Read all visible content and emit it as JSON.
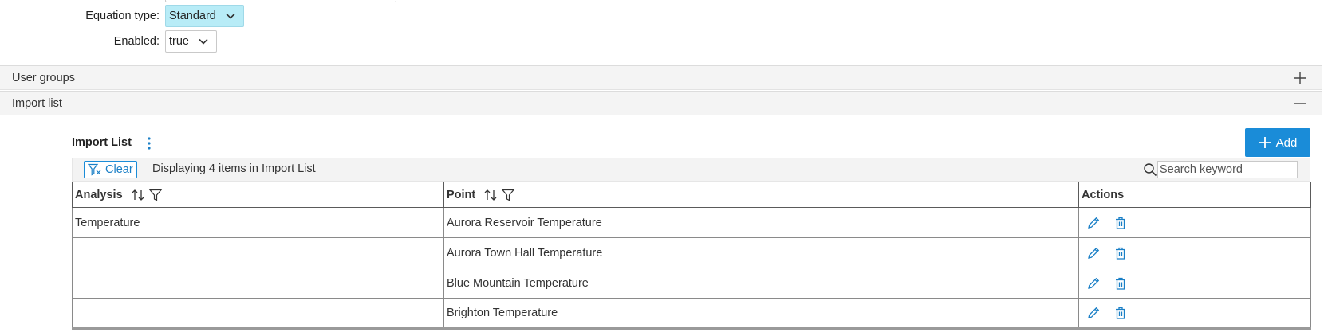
{
  "form": {
    "equation_type_label": "Equation type:",
    "equation_type_value": "Standard",
    "enabled_label": "Enabled:",
    "enabled_value": "true"
  },
  "panels": {
    "user_groups": "User groups",
    "import_list": "Import list"
  },
  "import_list": {
    "title": "Import List",
    "add_label": "Add",
    "clear_label": "Clear",
    "display_text": "Displaying 4 items in Import List",
    "search_placeholder": "Search keyword",
    "columns": [
      "Analysis",
      "Point",
      "Actions"
    ],
    "rows": [
      {
        "analysis": "Temperature",
        "point": "Aurora Reservoir Temperature"
      },
      {
        "analysis": "",
        "point": "Aurora Town Hall Temperature"
      },
      {
        "analysis": "",
        "point": "Blue Mountain Temperature"
      },
      {
        "analysis": "",
        "point": "Brighton Temperature"
      }
    ]
  },
  "colors": {
    "accent": "#1a8cd8",
    "highlight_select": "#b8ecf7",
    "panel_bg": "#f4f4f4"
  },
  "icons": [
    "chevron-down-icon",
    "plus-icon",
    "minus-icon",
    "kebab-menu-icon",
    "filter-clear-icon",
    "search-icon",
    "sort-icon",
    "filter-icon",
    "edit-icon",
    "delete-icon"
  ]
}
